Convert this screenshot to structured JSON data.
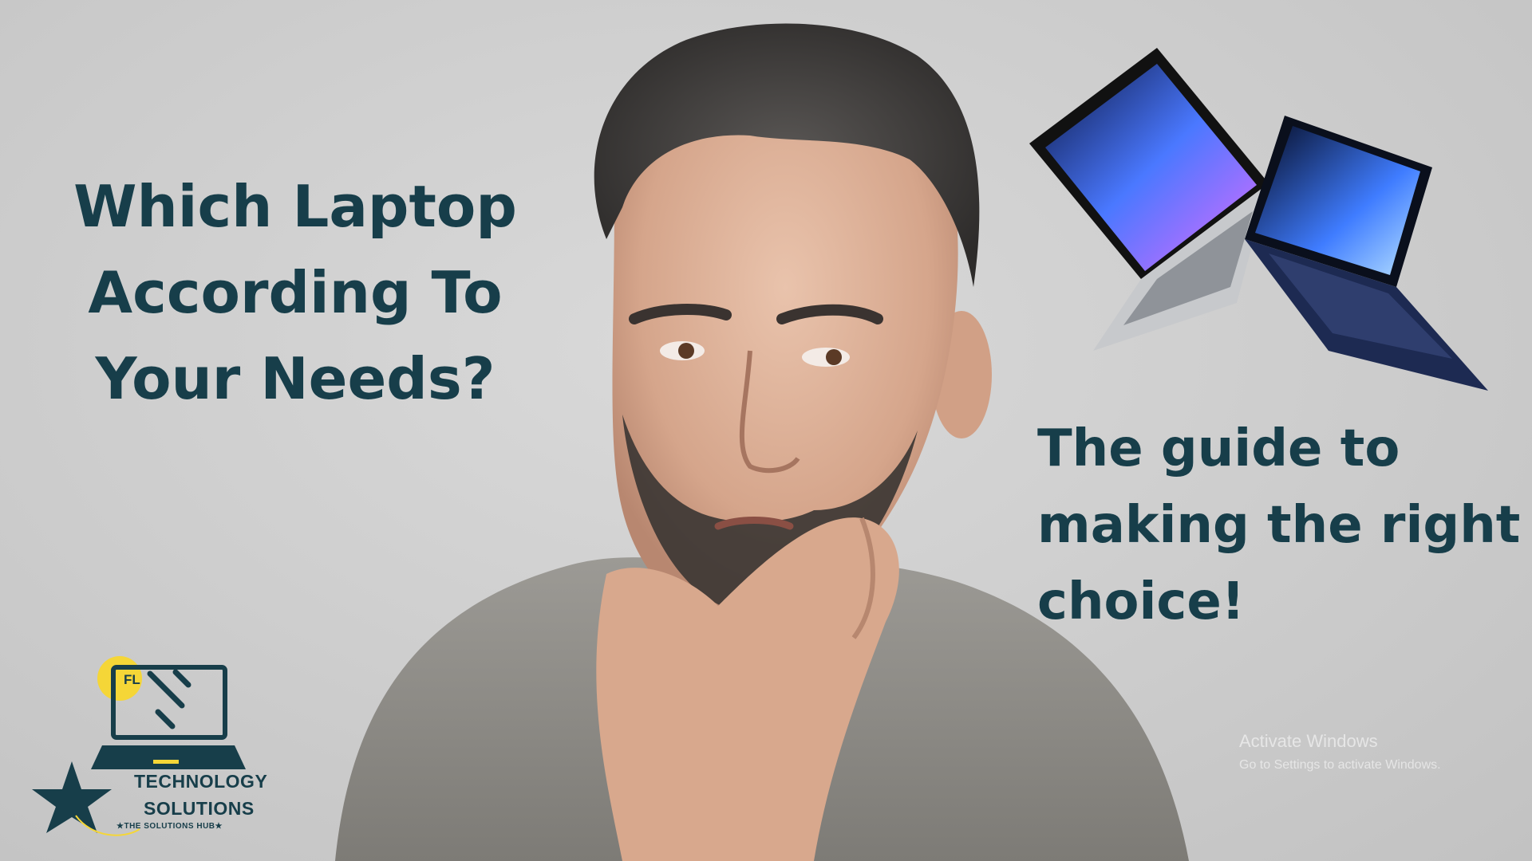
{
  "headline": {
    "line1": "Which Laptop",
    "line2": "According To",
    "line3": "Your Needs?"
  },
  "subline": {
    "line1": "The guide to",
    "line2": "making the right",
    "line3": "choice!"
  },
  "logo": {
    "badge_small": "FL",
    "line1": "TECHNOLOGY",
    "line2": "SOLUTIONS",
    "tagline": "★THE  SOLUTIONS HUB★",
    "star_letters": "FL"
  },
  "watermark": {
    "title": "Activate Windows",
    "subtitle": "Go to Settings to activate Windows."
  },
  "colors": {
    "text_primary": "#173e4a",
    "logo_yellow": "#f5d637",
    "background": "#cfcfcf"
  },
  "icons": {
    "laptop_silver": "laptop-silver-icon",
    "laptop_navy": "laptop-navy-icon",
    "logo_mark": "laptop-wrench-logo-icon"
  }
}
